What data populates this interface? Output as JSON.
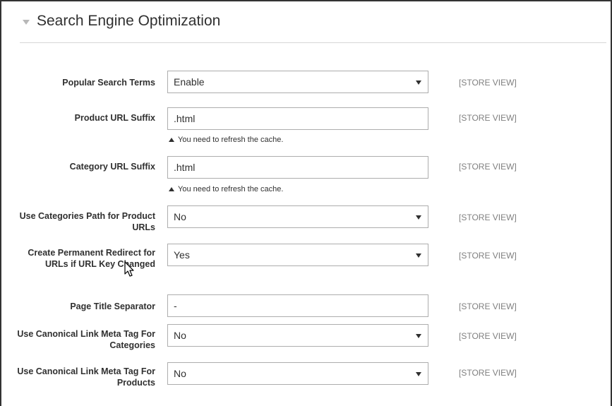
{
  "section": {
    "title": "Search Engine Optimization"
  },
  "scope_label": "[STORE VIEW]",
  "refresh_note": "You need to refresh the cache.",
  "fields": [
    {
      "label": "Popular Search Terms",
      "type": "select",
      "value": "Enable"
    },
    {
      "label": "Product URL Suffix",
      "type": "text",
      "value": ".html"
    },
    {
      "label": "Category URL Suffix",
      "type": "text",
      "value": ".html"
    },
    {
      "label": "Use Categories Path for Product URLs",
      "type": "select",
      "value": "No"
    },
    {
      "label": "Create Permanent Redirect for URLs if URL Key Changed",
      "type": "select",
      "value": "Yes"
    },
    {
      "label": "Page Title Separator",
      "type": "text",
      "value": "-"
    },
    {
      "label": "Use Canonical Link Meta Tag For Categories",
      "type": "select",
      "value": "No"
    },
    {
      "label": "Use Canonical Link Meta Tag For Products",
      "type": "select",
      "value": "No"
    }
  ],
  "icons": {
    "collapse": "collapse-triangle-icon",
    "dropdown": "chevron-down-icon",
    "note": "caret-up-icon",
    "cursor": "mouse-pointer-icon"
  }
}
